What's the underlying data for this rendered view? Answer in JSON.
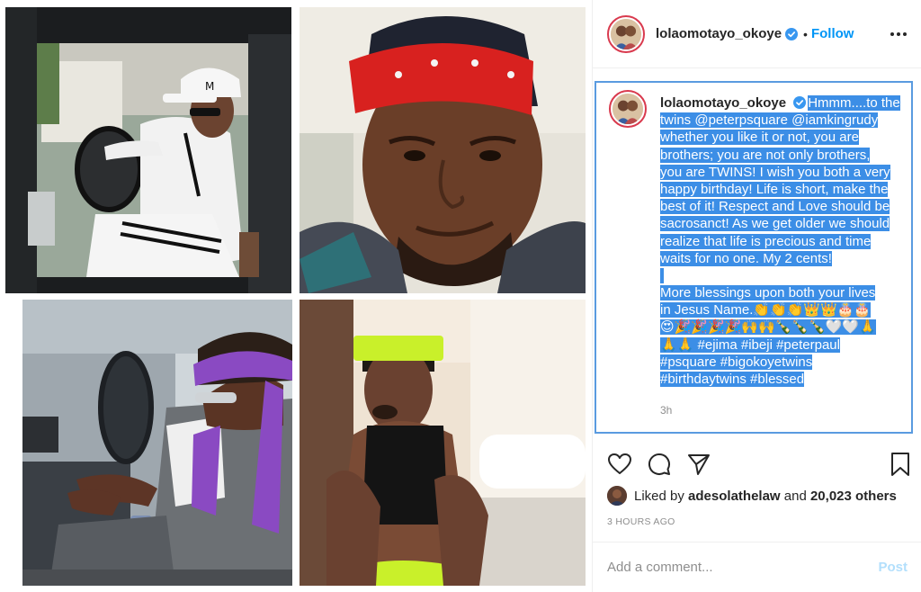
{
  "post": {
    "username": "lolaomotayo_okoye",
    "follow_label": "Follow",
    "separator": "•",
    "caption": {
      "lines": [
        "Hmmm....to the",
        "twins @peterpsquare @iamkingrudy",
        "whether you like it or not, you are",
        "brothers; you are not only brothers,",
        "you are TWINS! I wish you both a very",
        "happy birthday! Life is short, make the",
        "best of it! Respect and Love should be",
        "sacrosanct! As we get older we should",
        "realize that life is precious and time",
        "waits for no one. My 2 cents!"
      ],
      "lines2": [
        "More blessings upon both your lives",
        "in Jesus Name.👏👏👏👑👑🎂🎂",
        "😍🎉🎉🎉🎉🙌🙌🍾🍾🍾🤍🤍🙏",
        "🙏🙏 #ejima #ibeji #peterpaul",
        "#psquare #bigokoyetwins",
        "#birthdaytwins #blessed"
      ],
      "time": "3h"
    },
    "likes": {
      "prefix": "Liked by",
      "user": "adesolathelaw",
      "and": "and",
      "count": "20,023 others"
    },
    "time_ago": "3 HOURS AGO",
    "comment": {
      "placeholder": "Add a comment...",
      "post_label": "Post"
    }
  },
  "colors": {
    "accent": "#0095f6",
    "highlight": "#3c8ee6",
    "selection_border": "#5a9be0",
    "muted": "#8e8e8e",
    "post_disabled": "#b2dffc"
  },
  "icons": [
    "verified-badge-icon",
    "more-options-icon",
    "heart-icon",
    "comment-icon",
    "share-icon",
    "bookmark-icon"
  ]
}
